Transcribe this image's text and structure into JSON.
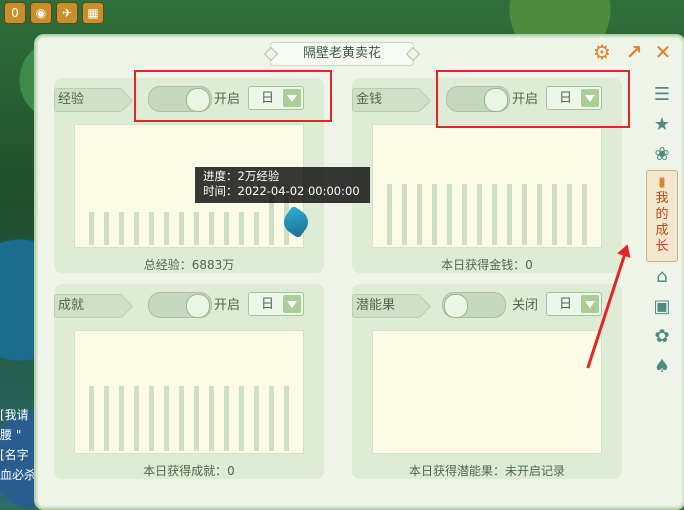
{
  "title": "隔壁老黄卖花",
  "topbar": {
    "icons": [
      "0",
      "◉",
      "✈",
      "▦"
    ]
  },
  "chat": {
    "lines": [
      "[我请",
      "腰 \"",
      "[名字",
      "血必杀"
    ]
  },
  "cards": [
    {
      "tag": "经验",
      "toggle_label": "开启",
      "toggle_state": "on",
      "select_value": "日",
      "caption": "总经验：6883万",
      "bar_levels": [
        0.27,
        0.27,
        0.27,
        0.27,
        0.27,
        0.27,
        0.27,
        0.27,
        0.27,
        0.27,
        0.27,
        0.27,
        0.47,
        0.47
      ]
    },
    {
      "tag": "金钱",
      "toggle_label": "开启",
      "toggle_state": "on",
      "select_value": "日",
      "caption": "本日获得金钱：0",
      "bar_levels": [
        0.5,
        0.5,
        0.5,
        0.5,
        0.5,
        0.5,
        0.5,
        0.5,
        0.5,
        0.5,
        0.5,
        0.5,
        0.5,
        0.5
      ]
    },
    {
      "tag": "成就",
      "toggle_label": "开启",
      "toggle_state": "on",
      "select_value": "日",
      "caption": "本日获得成就：0",
      "bar_levels": [
        0.53,
        0.53,
        0.53,
        0.53,
        0.53,
        0.53,
        0.53,
        0.53,
        0.53,
        0.53,
        0.53,
        0.53,
        0.53,
        0.53
      ]
    },
    {
      "tag": "潜能果",
      "toggle_label": "关闭",
      "toggle_state": "off",
      "select_value": "日",
      "caption": "本日获得潜能果：未开启记录",
      "bar_levels": []
    }
  ],
  "tooltip": {
    "line1": "进度：2万经验",
    "line2": "时间：2022-04-02 00:00:00"
  },
  "sidebar": {
    "active_label": "我的成长",
    "icons": [
      "chat-icon",
      "star-icon",
      "paw-icon",
      "home-icon",
      "box-icon",
      "palette-icon",
      "shirt-icon"
    ]
  },
  "colors": {
    "highlight": "#e32525",
    "accent": "#e0822d"
  }
}
